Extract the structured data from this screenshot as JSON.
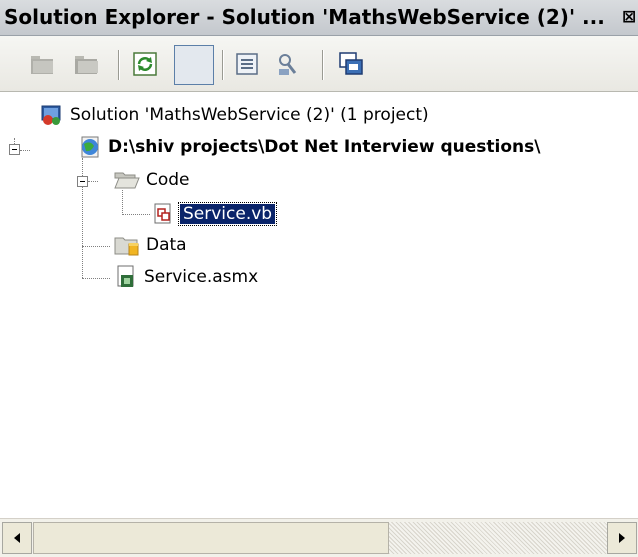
{
  "window": {
    "title": "Solution Explorer - Solution 'MathsWebService (2)' ...",
    "close_glyph": "⊠"
  },
  "toolbar": {
    "buttons": [
      "folder-up-icon",
      "new-folder-icon",
      "refresh-icon",
      "nested-files-icon",
      "properties-icon",
      "view-code-icon",
      "class-view-icon"
    ]
  },
  "tree": {
    "solution": "Solution 'MathsWebService (2)' (1 project)",
    "project": "D:\\shiv projects\\Dot Net Interview questions\\",
    "code_folder": "Code",
    "service_vb": "Service.vb",
    "data_folder": "Data",
    "service_asmx": "Service.asmx",
    "selected": "Service.vb"
  },
  "colors": {
    "selection_bg": "#0a246a",
    "selection_text": "#ffffff"
  }
}
